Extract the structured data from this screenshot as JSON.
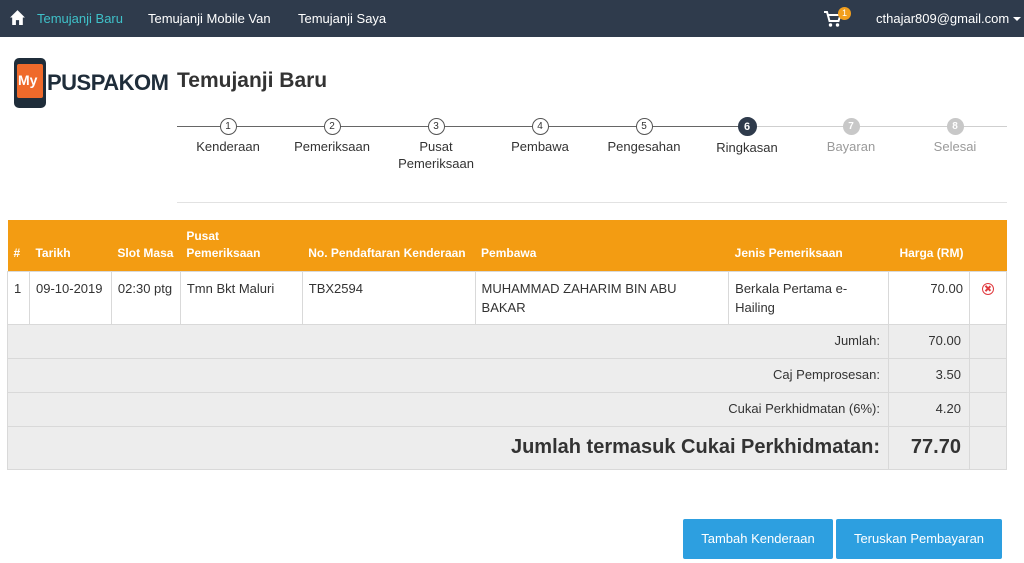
{
  "nav": {
    "home_icon": "home-icon",
    "links": [
      "Temujanji Baru",
      "Temujanji Mobile Van",
      "Temujanji Saya"
    ],
    "cart_icon": "cart-icon",
    "cart_count": "1",
    "user_email": "cthajar809@gmail.com"
  },
  "logo": {
    "my": "My",
    "name": "PUSPAKOM"
  },
  "page_title": "Temujanji Baru",
  "steps": [
    {
      "num": "1",
      "label": "Kenderaan",
      "state": "done"
    },
    {
      "num": "2",
      "label": "Pemeriksaan",
      "state": "done"
    },
    {
      "num": "3",
      "label": "Pusat Pemeriksaan",
      "state": "done"
    },
    {
      "num": "4",
      "label": "Pembawa",
      "state": "done"
    },
    {
      "num": "5",
      "label": "Pengesahan",
      "state": "done"
    },
    {
      "num": "6",
      "label": "Ringkasan",
      "state": "current"
    },
    {
      "num": "7",
      "label": "Bayaran",
      "state": "future"
    },
    {
      "num": "8",
      "label": "Selesai",
      "state": "future"
    }
  ],
  "table": {
    "headers": [
      "#",
      "Tarikh",
      "Slot Masa",
      "Pusat Pemeriksaan",
      "No. Pendaftaran Kenderaan",
      "Pembawa",
      "Jenis Pemeriksaan",
      "Harga (RM)"
    ],
    "rows": [
      {
        "no": "1",
        "tarikh": "09-10-2019",
        "slot": "02:30 ptg",
        "pusat": "Tmn Bkt Maluri",
        "no_pendaftaran": "TBX2594",
        "pembawa": "MUHAMMAD ZAHARIM BIN ABU BAKAR",
        "jenis": "Berkala Pertama e-Hailing",
        "harga": "70.00"
      }
    ],
    "summary": [
      {
        "label": "Jumlah:",
        "value": "70.00"
      },
      {
        "label": "Caj Pemprosesan:",
        "value": "3.50"
      },
      {
        "label": "Cukai Perkhidmatan (6%):",
        "value": "4.20"
      }
    ],
    "total_label": "Jumlah termasuk Cukai Perkhidmatan:",
    "total_value": "77.70"
  },
  "buttons": {
    "add_vehicle": "Tambah Kenderaan",
    "continue_payment": "Teruskan Pembayaran"
  },
  "colors": {
    "navbar": "#2f3b4c",
    "accent": "#3fc1c9",
    "table_header": "#f39c12",
    "button": "#2d9fe0",
    "delete": "#e0393e"
  }
}
